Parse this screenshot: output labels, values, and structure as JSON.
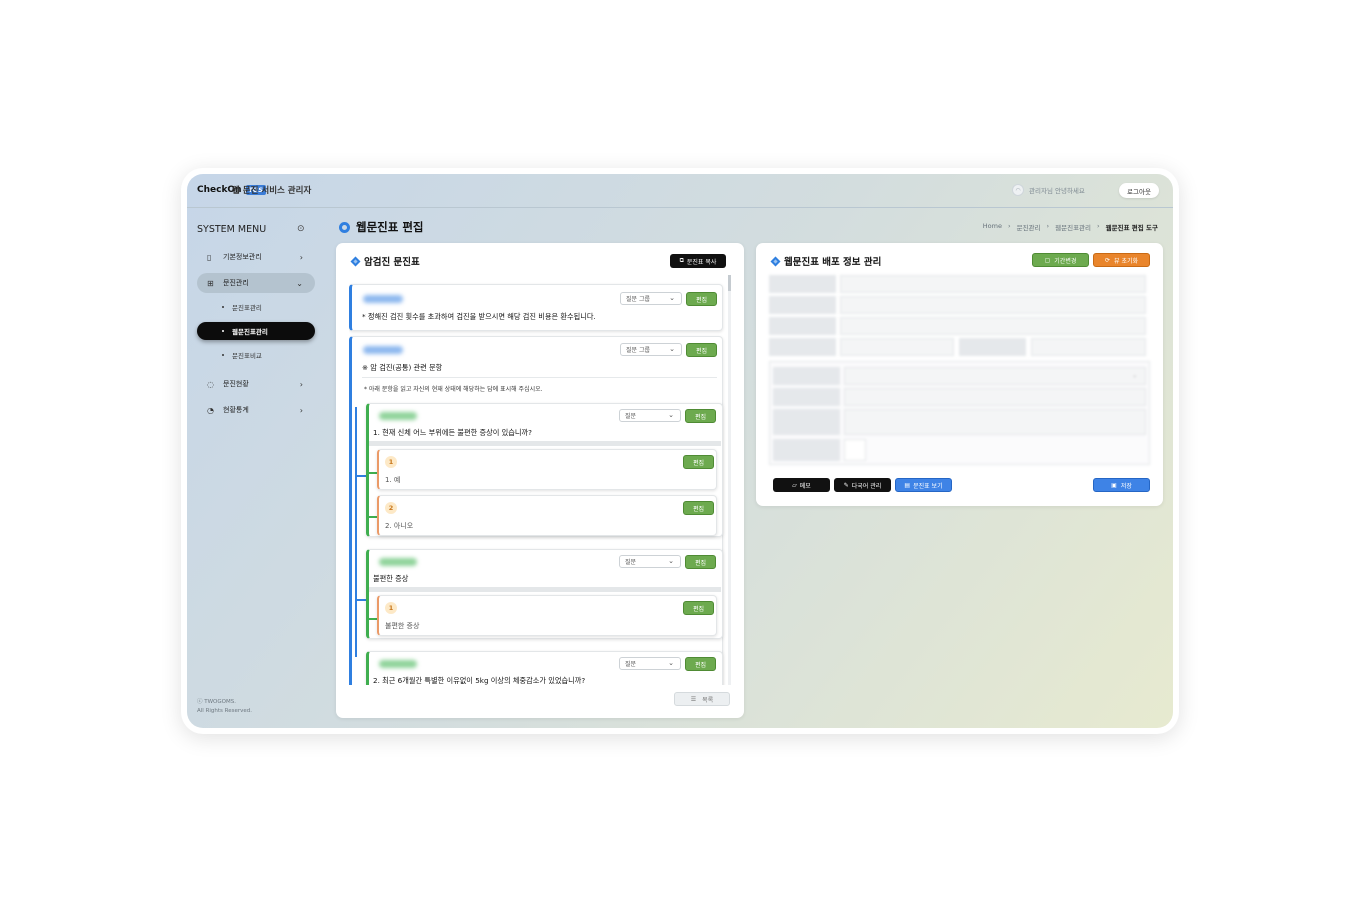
{
  "header": {
    "brand": "CheckOn",
    "brand_badge": "TGS",
    "service": "웹 문진 서비스 관리자",
    "greeting": "관리자님 안녕하세요",
    "logout": "로그아웃"
  },
  "sidebar": {
    "title": "SYSTEM MENU",
    "items": [
      {
        "label": "기본정보관리"
      },
      {
        "label": "문진관리"
      },
      {
        "label": "문진현황"
      },
      {
        "label": "현황통계"
      }
    ],
    "subitems": [
      {
        "label": "문진표관리"
      },
      {
        "label": "웹문진표관리"
      },
      {
        "label": "문진표비교"
      }
    ],
    "copyright": [
      "ⓒ TWOGOMS.",
      "All Rights Reserved."
    ]
  },
  "page": {
    "title": "웹문진표 편집",
    "breadcrumbs": [
      "Home",
      "문진관리",
      "웹문진표관리",
      "웹문진표 편집 도구"
    ]
  },
  "editor": {
    "title": "암검진 문진표",
    "copy_button": "문진표 복사",
    "edit_label": "편집",
    "list_button": "목록",
    "blocks": [
      {
        "select": "질문 그룹",
        "text": "* 정해진 검진 횟수를 초과하여 검진을 받으시면 해당 검진 비용은 환수됩니다."
      },
      {
        "select": "질문 그룹",
        "text": "※ 암 검진(공통) 관련 문항",
        "note": "* 아래 문항을 읽고 자신의 현재 상태에 해당하는 답에 표시해 주십시오."
      }
    ],
    "questions": [
      {
        "select": "질문",
        "text": "1. 현재 신체 어느 부위에든 불편한 증상이 있습니까?"
      },
      {
        "select": "질문",
        "text": "불편한 증상"
      },
      {
        "select": "질문",
        "text": "2. 최근 6개월간 특별한 이유없이 5kg 이상의 체중감소가 있었습니까?"
      }
    ],
    "options": [
      {
        "num": "1",
        "text": "1. 예"
      },
      {
        "num": "2",
        "text": "2. 아니오"
      },
      {
        "num": "1",
        "text": "불편한 증상"
      }
    ]
  },
  "deploy": {
    "title": "웹문진표 배포 정보 관리",
    "period_button": "기간변경",
    "reset_button": "뷰 초기화",
    "memo_button": "메모",
    "lang_button": "다국어 관리",
    "view_button": "문진표 보기",
    "save_button": "저장"
  },
  "colors": {
    "accent_blue": "#2f7fe0",
    "edit_green": "#6daa4f",
    "reset_orange": "#e9852c",
    "active_menu": "#0c0c0c"
  }
}
